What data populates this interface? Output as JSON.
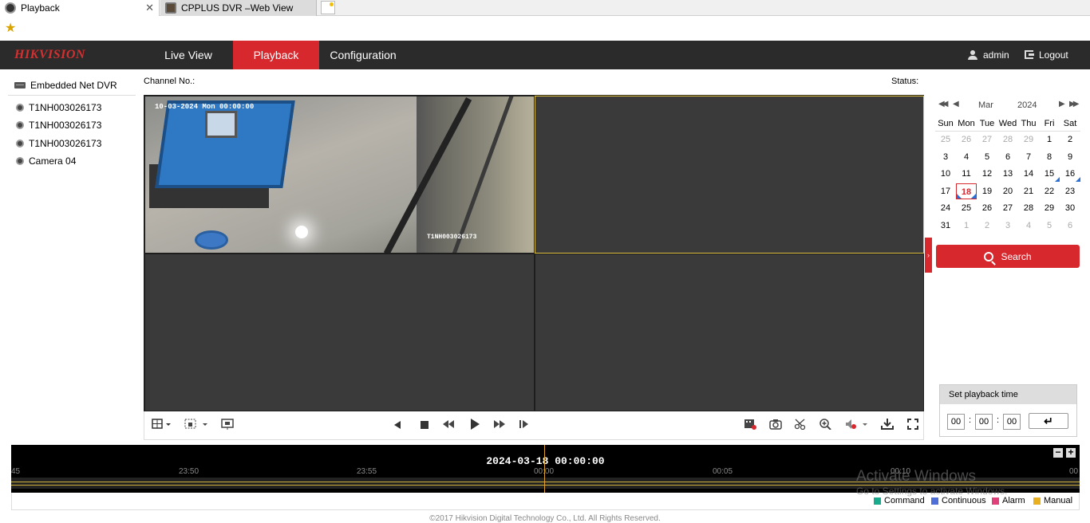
{
  "browser": {
    "tabs": [
      {
        "title": "Playback",
        "close": "✕"
      },
      {
        "title": "CPPLUS DVR –Web View"
      }
    ]
  },
  "header": {
    "logo": "HIKVISION",
    "nav": [
      "Live View",
      "Playback",
      "Configuration"
    ],
    "active_nav": "Playback",
    "user": "admin",
    "logout": "Logout",
    "accent": "#d7282e"
  },
  "tree": {
    "root": "Embedded Net DVR",
    "cameras": [
      "T1NH003026173",
      "T1NH003026173",
      "T1NH003026173",
      "Camera 04"
    ]
  },
  "labels": {
    "channel": "Channel No.:",
    "status": "Status:"
  },
  "video": {
    "osd_time": "10-03-2024 Mon 00:00:00",
    "osd_name": "T1NH003026173"
  },
  "calendar": {
    "month": "Mar",
    "year": "2024",
    "dows": [
      "Sun",
      "Mon",
      "Tue",
      "Wed",
      "Thu",
      "Fri",
      "Sat"
    ],
    "weeks": [
      [
        "25",
        "26",
        "27",
        "28",
        "29",
        "1",
        "2"
      ],
      [
        "3",
        "4",
        "5",
        "6",
        "7",
        "8",
        "9"
      ],
      [
        "10",
        "11",
        "12",
        "13",
        "14",
        "15",
        "16"
      ],
      [
        "17",
        "18",
        "19",
        "20",
        "21",
        "22",
        "23"
      ],
      [
        "24",
        "25",
        "26",
        "27",
        "28",
        "29",
        "30"
      ],
      [
        "31",
        "1",
        "2",
        "3",
        "4",
        "5",
        "6"
      ]
    ],
    "selected": "18",
    "record_marker_color": "#2a6fd6"
  },
  "search": {
    "label": "Search"
  },
  "playback_time": {
    "title": "Set playback time",
    "hh": "00",
    "mm": "00",
    "ss": "00",
    "enter": "↵"
  },
  "timeline": {
    "current": "2024-03-18 00:00:00",
    "ticks": [
      "45",
      "23:50",
      "23:55",
      "00:00",
      "00:05",
      "00:10",
      "00"
    ],
    "zoom_out": "−",
    "zoom_in": "+"
  },
  "legend": [
    {
      "label": "Command",
      "color": "#19a98c"
    },
    {
      "label": "Continuous",
      "color": "#4f6fd8"
    },
    {
      "label": "Alarm",
      "color": "#e0407a"
    },
    {
      "label": "Manual",
      "color": "#e8b020"
    }
  ],
  "footer": "©2017 Hikvision Digital Technology Co., Ltd. All Rights Reserved.",
  "watermark": {
    "line1": "Activate Windows",
    "line2": "Go to Settings to activate Windows."
  }
}
